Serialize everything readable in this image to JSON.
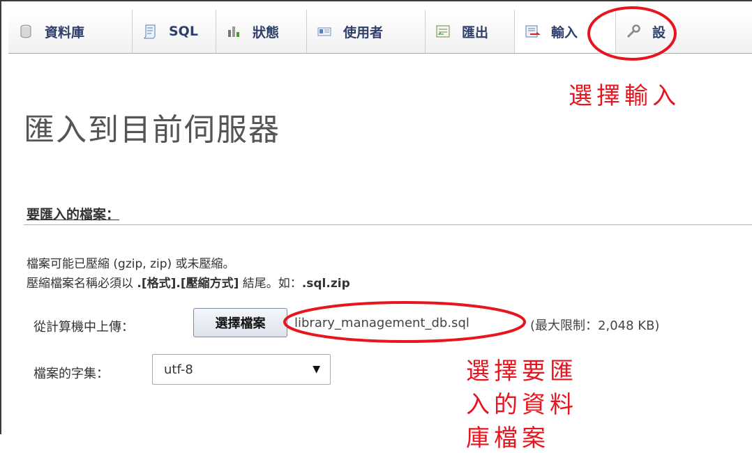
{
  "tabs": [
    {
      "label": "資料庫",
      "icon": "database-icon"
    },
    {
      "label": "SQL",
      "icon": "sql-icon"
    },
    {
      "label": "狀態",
      "icon": "status-icon"
    },
    {
      "label": "使用者",
      "icon": "users-icon"
    },
    {
      "label": "匯出",
      "icon": "export-icon"
    },
    {
      "label": "輸入",
      "icon": "import-icon",
      "active": true
    },
    {
      "label": "設",
      "icon": "wrench-icon"
    }
  ],
  "page": {
    "title": "匯入到目前伺服器",
    "legend": "要匯入的檔案：",
    "note1": "檔案可能已壓縮 (gzip, zip) 或未壓縮。",
    "note2_prefix": "壓縮檔案名稱必須以 ",
    "note2_bold1": ".[格式].[壓縮方式]",
    "note2_mid": " 結尾。如：",
    "note2_bold2": ".sql.zip"
  },
  "upload": {
    "label": "從計算機中上傳：",
    "button": "選擇檔案",
    "file_name": "library_management_db.sql",
    "max_size": "(最大限制：2,048 KB)"
  },
  "charset": {
    "label": "檔案的字集：",
    "value": "utf-8",
    "arrow": "▼"
  },
  "annotations": {
    "import_tab": "選擇輸入",
    "file_line1": "選擇要匯",
    "file_line2": "入的資料",
    "file_line3": "庫檔案"
  },
  "colors": {
    "annotation": "#e8141e",
    "tab_text": "#2f3f6b"
  }
}
